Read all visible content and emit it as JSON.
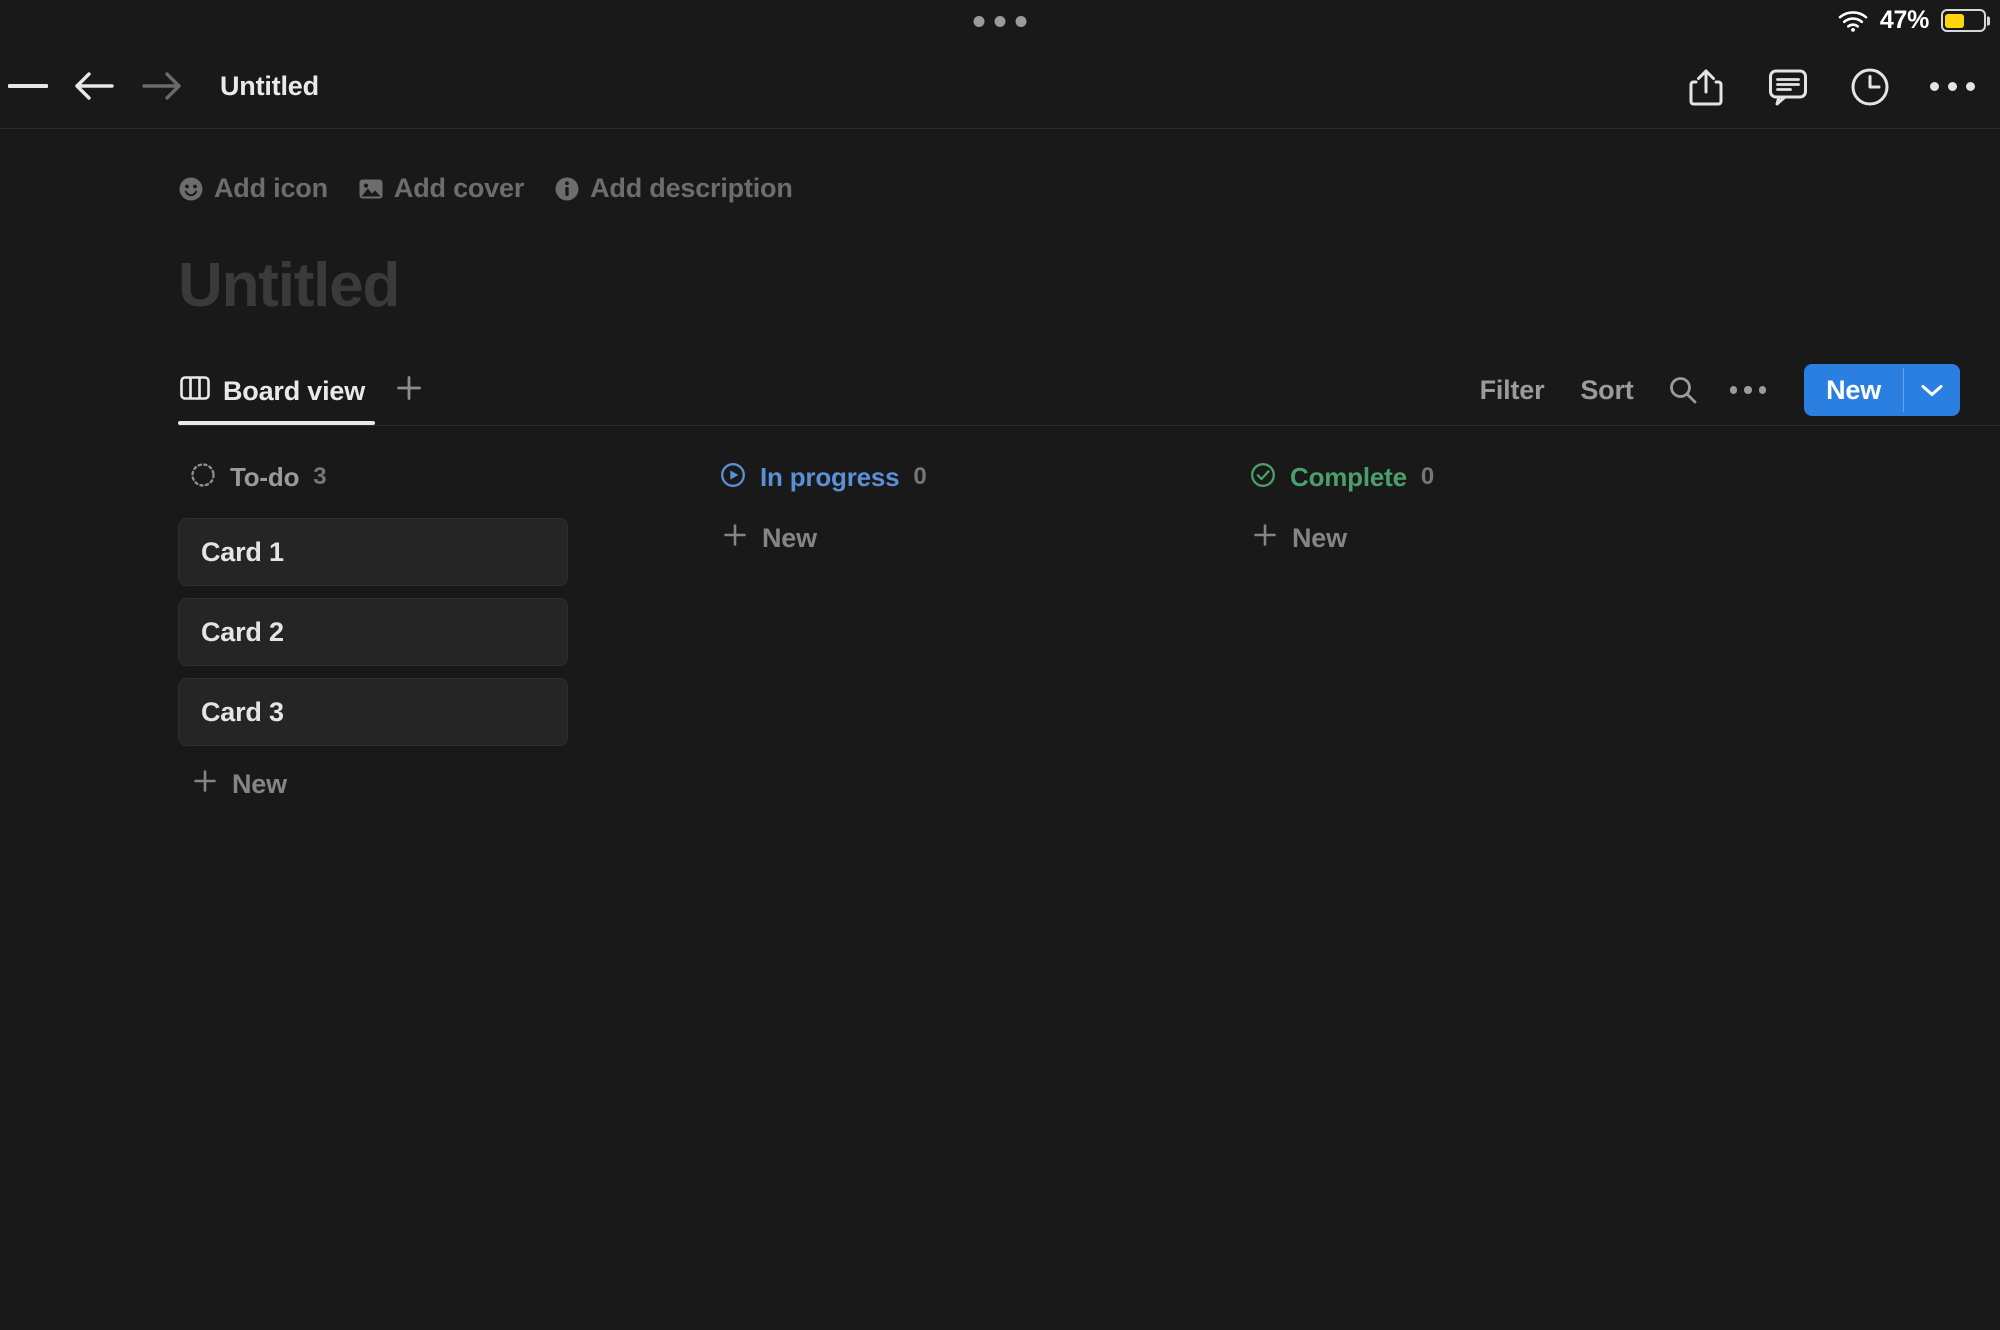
{
  "status_bar": {
    "wifi_icon": "wifi-icon",
    "battery_percent": "47%",
    "battery_level": 47,
    "battery_color": "#FFD60A",
    "multitask_handle": "multitask-handle-icon"
  },
  "nav": {
    "menu_icon": "hamburger-menu-icon",
    "back_icon": "arrow-left-icon",
    "forward_icon": "arrow-right-icon",
    "title": "Untitled",
    "share_icon": "share-icon",
    "comment_icon": "comment-icon",
    "history_icon": "clock-history-icon",
    "more_icon": "more-horizontal-icon"
  },
  "page_meta": [
    {
      "label": "Add icon",
      "icon": "smiley-face-icon"
    },
    {
      "label": "Add cover",
      "icon": "image-icon"
    },
    {
      "label": "Add description",
      "icon": "info-circle-icon"
    }
  ],
  "page": {
    "title_placeholder": "Untitled"
  },
  "view_bar": {
    "tabs": [
      {
        "label": "Board view",
        "icon": "board-view-icon",
        "active": true
      }
    ],
    "add_view_icon": "plus-icon",
    "filter_label": "Filter",
    "sort_label": "Sort",
    "search_icon": "search-icon",
    "more_icon": "more-horizontal-icon",
    "new_label": "New",
    "new_caret_icon": "chevron-down-icon",
    "new_button_color": "#2B7FE0"
  },
  "board": {
    "new_row_label": "New",
    "new_row_icon": "plus-icon",
    "columns": [
      {
        "name": "To-do",
        "count": "3",
        "color": "#9b9b9b",
        "icon": "dotted-circle-icon",
        "cards": [
          {
            "title": "Card 1"
          },
          {
            "title": "Card 2"
          },
          {
            "title": "Card 3"
          }
        ]
      },
      {
        "name": "In progress",
        "count": "0",
        "color": "#5b8fd6",
        "icon": "play-circle-icon",
        "cards": []
      },
      {
        "name": "Complete",
        "count": "0",
        "color": "#4aa06a",
        "icon": "check-circle-icon",
        "cards": []
      }
    ]
  }
}
